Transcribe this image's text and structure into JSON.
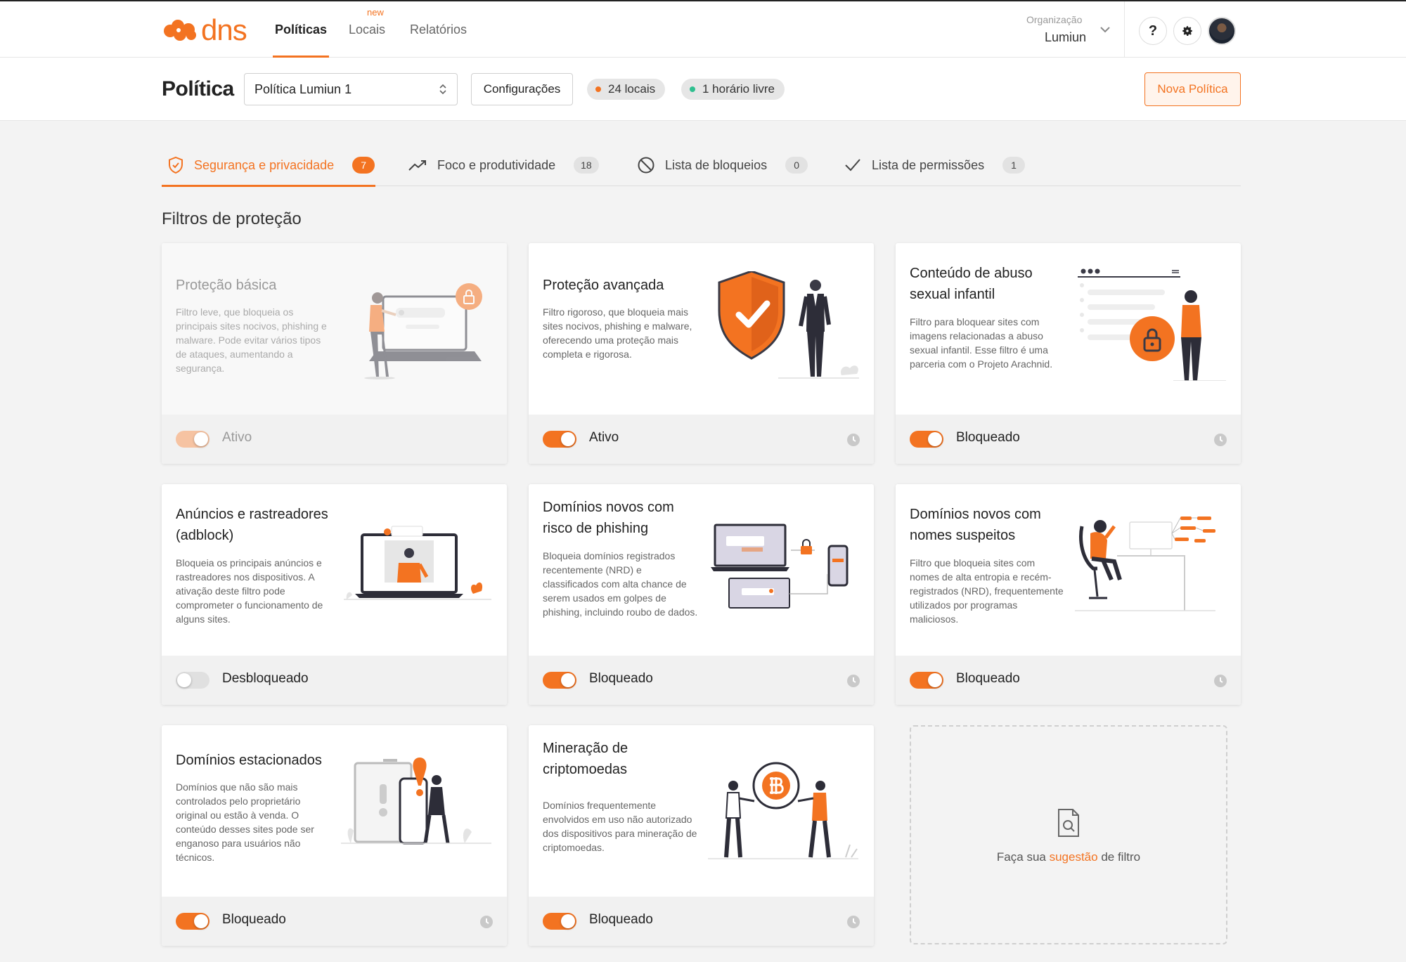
{
  "nav": {
    "logo_text": "dns",
    "links": [
      "Políticas",
      "Locais",
      "Relatórios"
    ],
    "new_badge": "new",
    "org_label": "Organização",
    "org_name": "Lumiun",
    "help_label": "?",
    "brand_color": "#f37321"
  },
  "policy": {
    "title": "Política",
    "selected": "Política Lumiun 1",
    "config_label": "Configurações",
    "locations": "24 locais",
    "schedule": "1 horário livre",
    "new_label": "Nova Política"
  },
  "tabs": [
    {
      "label": "Segurança e privacidade",
      "count": "7",
      "icon": "shield-check-icon"
    },
    {
      "label": "Foco e produtividade",
      "count": "18",
      "icon": "trend-up-icon"
    },
    {
      "label": "Lista de bloqueios",
      "count": "0",
      "icon": "block-icon"
    },
    {
      "label": "Lista de permissões",
      "count": "1",
      "icon": "check-icon"
    }
  ],
  "section_title": "Filtros de proteção",
  "cards": [
    {
      "title": "Proteção básica",
      "desc": "Filtro leve, que bloqueia os principais sites nocivos, phishing e malware. Pode evitar vários tipos de ataques, aumentando a segurança.",
      "status": "Ativo",
      "enabled": true
    },
    {
      "title": "Proteção avançada",
      "desc": "Filtro rigoroso, que bloqueia mais sites nocivos, phishing e malware, oferecendo uma proteção mais completa e rigorosa.",
      "status": "Ativo",
      "enabled": true
    },
    {
      "title": "Conteúdo de abuso sexual infantil",
      "desc": "Filtro para bloquear sites com imagens relacionadas a abuso sexual infantil. Esse filtro é uma parceria com o Projeto Arachnid.",
      "status": "Bloqueado",
      "enabled": true
    },
    {
      "title": "Anúncios e rastreadores (adblock)",
      "desc": "Bloqueia os principais anúncios e rastreadores nos dispositivos. A ativação deste filtro pode comprometer o funcionamento de alguns sites.",
      "status": "Desbloqueado",
      "enabled": false
    },
    {
      "title": "Domínios novos com risco de phishing",
      "desc": "Bloqueia domínios registrados recentemente (NRD) e classificados com alta chance de serem usados em golpes de phishing, incluindo roubo de dados.",
      "status": "Bloqueado",
      "enabled": true
    },
    {
      "title": "Domínios novos com nomes suspeitos",
      "desc": "Filtro que bloqueia sites com nomes de alta entropia e recém-registrados (NRD), frequentemente utilizados por programas maliciosos.",
      "status": "Bloqueado",
      "enabled": true
    },
    {
      "title": "Domínios estacionados",
      "desc": "Domínios que não são mais controlados pelo proprietário original ou estão à venda. O conteúdo desses sites pode ser enganoso para usuários não técnicos.",
      "status": "Bloqueado",
      "enabled": true
    },
    {
      "title": "Mineração de criptomoedas",
      "desc": "Domínios frequentemente envolvidos em uso não autorizado dos dispositivos para mineração de criptomoedas.",
      "status": "Bloqueado",
      "enabled": true
    }
  ],
  "suggestion": {
    "prefix": "Faça sua",
    "link": "sugestão",
    "suffix": "de filtro"
  }
}
